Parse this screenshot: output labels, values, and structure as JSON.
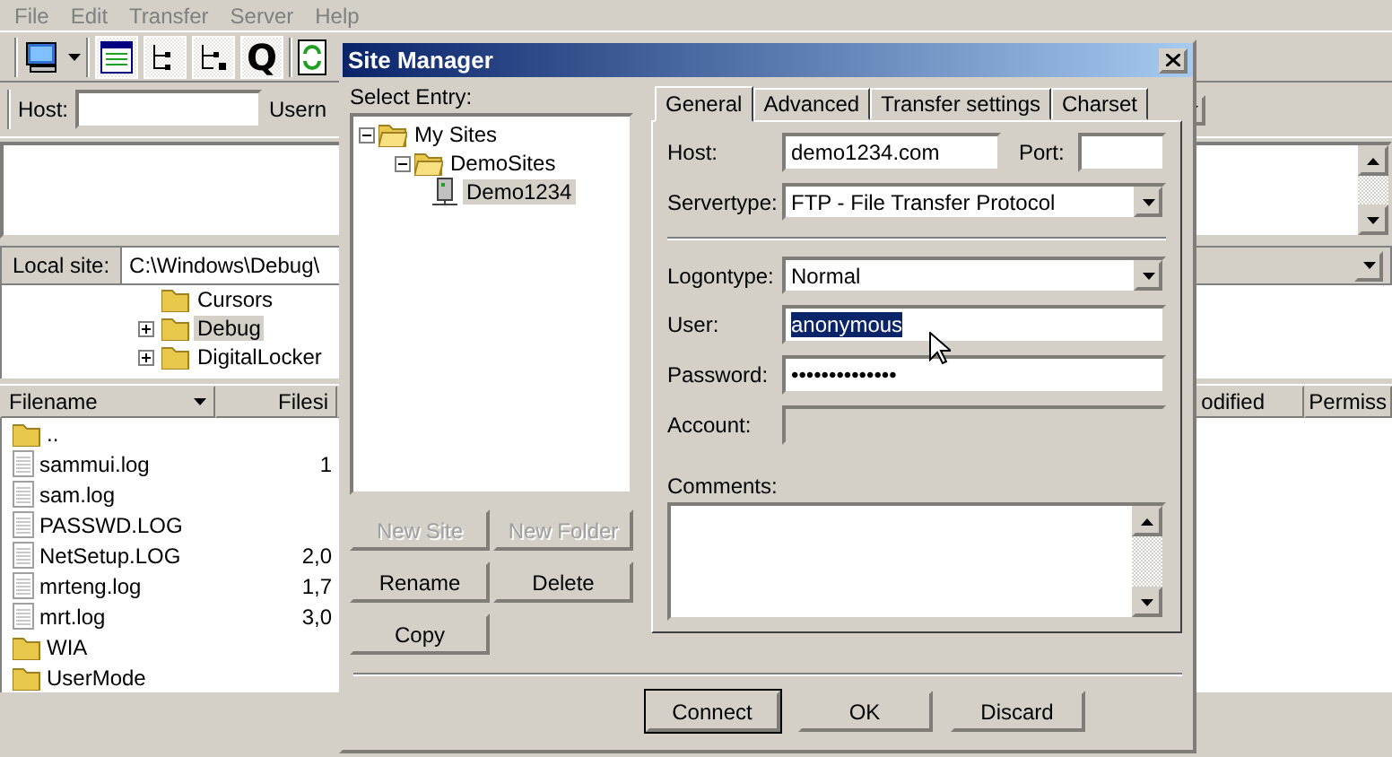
{
  "menu": [
    "File",
    "Edit",
    "Transfer",
    "Server",
    "Help"
  ],
  "toolbar": {
    "toggles": [
      {
        "kind": "log",
        "on": true
      },
      {
        "kind": "localtree",
        "on": true
      },
      {
        "kind": "remotetree",
        "on": true
      },
      {
        "kind": "queue",
        "on": true,
        "glyph": "Q"
      }
    ]
  },
  "quickconnect": {
    "host_label": "Host:",
    "user_label": "Usern"
  },
  "local_site": {
    "label": "Local site:",
    "path": "C:\\Windows\\Debug\\",
    "tree": [
      {
        "name": "Cursors",
        "kind": "leaf",
        "selected": false
      },
      {
        "name": "Debug",
        "kind": "collapsed",
        "selected": true
      },
      {
        "name": "DigitalLocker",
        "kind": "collapsed",
        "selected": false
      }
    ]
  },
  "local_files": {
    "columns": [
      "Filename",
      "Filesi"
    ],
    "rows": [
      {
        "name": "..",
        "kind": "folder"
      },
      {
        "name": "sammui.log",
        "kind": "file",
        "size": "1"
      },
      {
        "name": "sam.log",
        "kind": "file"
      },
      {
        "name": "PASSWD.LOG",
        "kind": "file"
      },
      {
        "name": "NetSetup.LOG",
        "kind": "file",
        "size": "2,0"
      },
      {
        "name": "mrteng.log",
        "kind": "file",
        "size": "1,7"
      },
      {
        "name": "mrt.log",
        "kind": "file",
        "size": "3,0"
      },
      {
        "name": "WIA",
        "kind": "folder"
      },
      {
        "name": "UserMode",
        "kind": "folder"
      }
    ]
  },
  "remote_files": {
    "columns": [
      "odified",
      "Permiss"
    ]
  },
  "dialog": {
    "title": "Site Manager",
    "select_label": "Select Entry:",
    "tree": [
      {
        "name": "My Sites",
        "kind": "folder",
        "selected": false,
        "expanded": true,
        "children": [
          {
            "name": "DemoSites",
            "kind": "folder",
            "selected": false,
            "expanded": true,
            "children": [
              {
                "name": "Demo1234",
                "kind": "site",
                "selected": true
              }
            ]
          }
        ]
      }
    ],
    "entry_buttons": [
      {
        "label": "New Site",
        "disabled": true
      },
      {
        "label": "New Folder",
        "disabled": true
      },
      {
        "label": "Rename",
        "disabled": false
      },
      {
        "label": "Delete",
        "disabled": false
      },
      {
        "label": "Copy",
        "disabled": false
      }
    ],
    "tabs": [
      {
        "label": "General",
        "selected": true
      },
      {
        "label": "Advanced",
        "selected": false
      },
      {
        "label": "Transfer settings",
        "selected": false
      },
      {
        "label": "Charset",
        "selected": false
      }
    ],
    "host": {
      "label": "Host:",
      "value": "demo1234.com"
    },
    "port": {
      "label": "Port:"
    },
    "servertype": {
      "label": "Servertype:",
      "value": "FTP - File Transfer Protocol"
    },
    "logontype": {
      "label": "Logontype:",
      "value": "Normal"
    },
    "user": {
      "label": "User:",
      "value": "anonymous",
      "text_selected": true
    },
    "password": {
      "label": "Password:",
      "value": "••••••••••••••"
    },
    "account": {
      "label": "Account:",
      "disabled": true
    },
    "comments": {
      "label": "Comments:"
    },
    "footer_buttons": [
      {
        "label": "Connect",
        "default": true
      },
      {
        "label": "OK",
        "default": false
      },
      {
        "label": "Discard",
        "default": false
      }
    ]
  }
}
